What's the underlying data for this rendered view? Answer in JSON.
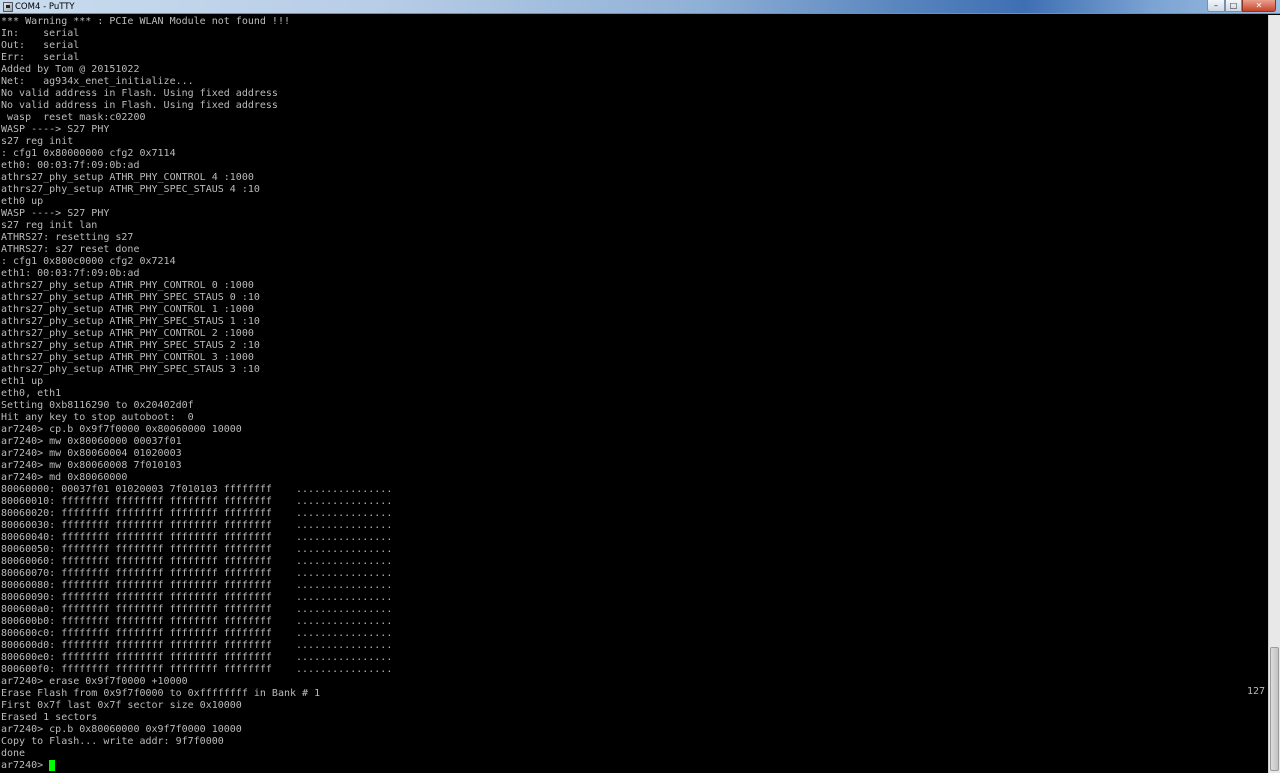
{
  "window": {
    "title": "COM4 - PuTTY",
    "minimize_glyph": "–",
    "maximize_glyph": "□",
    "close_glyph": "✕"
  },
  "terminal": {
    "lines": [
      "*** Warning *** : PCIe WLAN Module not found !!!",
      "In:    serial",
      "Out:   serial",
      "Err:   serial",
      "Added by Tom @ 20151022",
      "Net:   ag934x_enet_initialize...",
      "No valid address in Flash. Using fixed address",
      "No valid address in Flash. Using fixed address",
      " wasp  reset mask:c02200",
      "WASP ----> S27 PHY",
      "s27 reg init",
      ": cfg1 0x80000000 cfg2 0x7114",
      "eth0: 00:03:7f:09:0b:ad",
      "athrs27_phy_setup ATHR_PHY_CONTROL 4 :1000",
      "athrs27_phy_setup ATHR_PHY_SPEC_STAUS 4 :10",
      "eth0 up",
      "WASP ----> S27 PHY",
      "s27 reg init lan",
      "ATHRS27: resetting s27",
      "ATHRS27: s27 reset done",
      ": cfg1 0x800c0000 cfg2 0x7214",
      "eth1: 00:03:7f:09:0b:ad",
      "athrs27_phy_setup ATHR_PHY_CONTROL 0 :1000",
      "athrs27_phy_setup ATHR_PHY_SPEC_STAUS 0 :10",
      "athrs27_phy_setup ATHR_PHY_CONTROL 1 :1000",
      "athrs27_phy_setup ATHR_PHY_SPEC_STAUS 1 :10",
      "athrs27_phy_setup ATHR_PHY_CONTROL 2 :1000",
      "athrs27_phy_setup ATHR_PHY_SPEC_STAUS 2 :10",
      "athrs27_phy_setup ATHR_PHY_CONTROL 3 :1000",
      "athrs27_phy_setup ATHR_PHY_SPEC_STAUS 3 :10",
      "eth1 up",
      "eth0, eth1",
      "Setting 0xb8116290 to 0x20402d0f",
      "Hit any key to stop autoboot:  0",
      "ar7240> cp.b 0x9f7f0000 0x80060000 10000",
      "ar7240> mw 0x80060000 00037f01",
      "ar7240> mw 0x80060004 01020003",
      "ar7240> mw 0x80060008 7f010103",
      "ar7240> md 0x80060000",
      "80060000: 00037f01 01020003 7f010103 ffffffff    ................",
      "80060010: ffffffff ffffffff ffffffff ffffffff    ................",
      "80060020: ffffffff ffffffff ffffffff ffffffff    ................",
      "80060030: ffffffff ffffffff ffffffff ffffffff    ................",
      "80060040: ffffffff ffffffff ffffffff ffffffff    ................",
      "80060050: ffffffff ffffffff ffffffff ffffffff    ................",
      "80060060: ffffffff ffffffff ffffffff ffffffff    ................",
      "80060070: ffffffff ffffffff ffffffff ffffffff    ................",
      "80060080: ffffffff ffffffff ffffffff ffffffff    ................",
      "80060090: ffffffff ffffffff ffffffff ffffffff    ................",
      "800600a0: ffffffff ffffffff ffffffff ffffffff    ................",
      "800600b0: ffffffff ffffffff ffffffff ffffffff    ................",
      "800600c0: ffffffff ffffffff ffffffff ffffffff    ................",
      "800600d0: ffffffff ffffffff ffffffff ffffffff    ................",
      "800600e0: ffffffff ffffffff ffffffff ffffffff    ................",
      "800600f0: ffffffff ffffffff ffffffff ffffffff    ................",
      "ar7240> erase 0x9f7f0000 +10000",
      "Erase Flash from 0x9f7f0000 to 0xffffffff in Bank # 1",
      "First 0x7f last 0x7f sector size 0x10000",
      "Erased 1 sectors",
      "ar7240> cp.b 0x80060000 0x9f7f0000 10000",
      "Copy to Flash... write addr: 9f7f0000",
      "done"
    ],
    "prompt": "ar7240> ",
    "side_number": "127",
    "text_color": "#bbbbbb",
    "cursor_color": "#00ff00",
    "background_color": "#000000"
  }
}
